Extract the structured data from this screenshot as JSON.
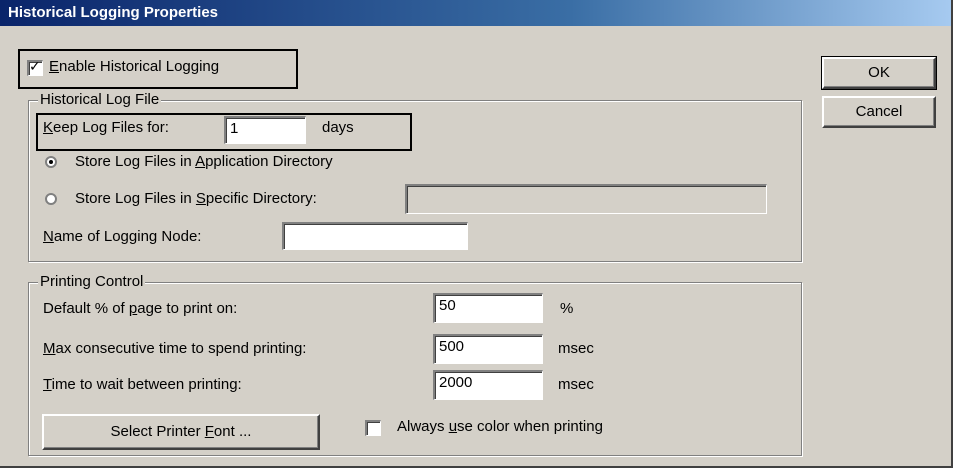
{
  "window": {
    "title": "Historical Logging Properties"
  },
  "enable_logging": {
    "pre": "",
    "accel": "E",
    "post": "nable Historical Logging",
    "checked": true
  },
  "log_file_group": {
    "title": "Historical Log File",
    "keep_label": {
      "pre": "",
      "accel": "K",
      "post": "eep Log Files for:"
    },
    "keep_value": "1",
    "keep_unit": "days",
    "store_app": {
      "pre": "Store Log Files in ",
      "accel": "A",
      "post": "pplication Directory",
      "selected": true
    },
    "store_specific": {
      "pre": "Store Log Files in ",
      "accel": "S",
      "post": "pecific Directory:",
      "selected": false
    },
    "specific_dir_value": "",
    "node_label": {
      "pre": "",
      "accel": "N",
      "post": "ame of Logging Node:"
    },
    "node_value": ""
  },
  "printing_group": {
    "title": "Printing Control",
    "default_pct_label": {
      "pre": "Default % of ",
      "accel": "p",
      "post": "age to print on:"
    },
    "default_pct_value": "50",
    "default_pct_unit": "%",
    "max_time_label": {
      "pre": "",
      "accel": "M",
      "post": "ax consecutive time to spend printing:"
    },
    "max_time_value": "500",
    "max_time_unit": "msec",
    "wait_label": {
      "pre": "",
      "accel": "T",
      "post": "ime to wait between printing:"
    },
    "wait_value": "2000",
    "wait_unit": "msec",
    "font_button": {
      "pre": "Select Printer ",
      "accel": "F",
      "post": "ont ..."
    },
    "always_color": {
      "pre": "Always ",
      "accel": "u",
      "post": "se color when printing",
      "checked": false
    }
  },
  "buttons": {
    "ok": "OK",
    "cancel": "Cancel"
  }
}
